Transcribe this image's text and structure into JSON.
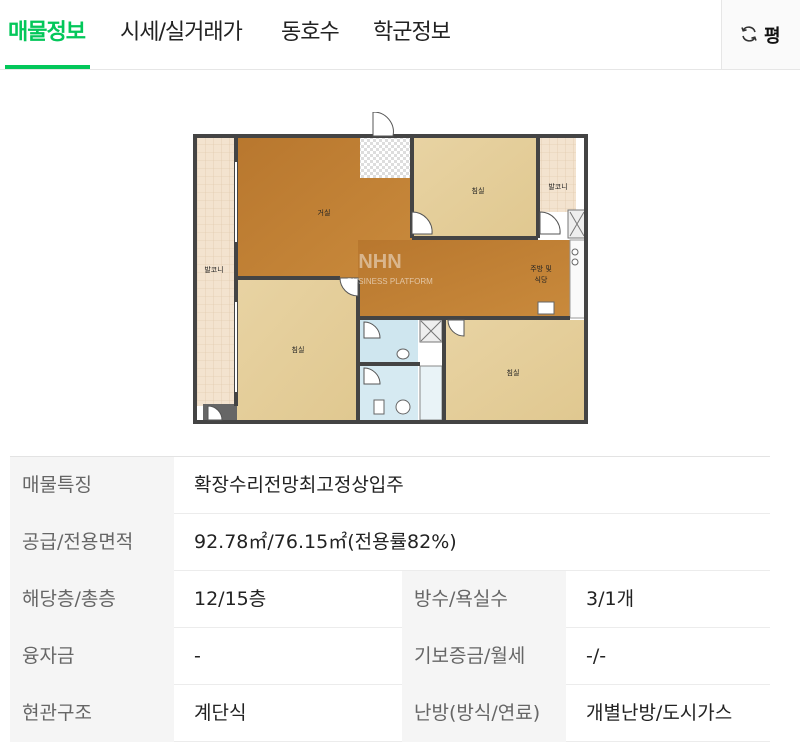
{
  "tabs": [
    {
      "label": "매물정보",
      "active": true
    },
    {
      "label": "시세/실거래가",
      "active": false
    },
    {
      "label": "동호수",
      "active": false
    },
    {
      "label": "학군정보",
      "active": false
    }
  ],
  "unit_toggle": {
    "icon": "refresh-icon",
    "label": "평"
  },
  "accent_color": "#03c75a",
  "floorplan": {
    "watermark": "NHN",
    "watermark_sub": "BUSINESS PLATFORM",
    "rooms": {
      "living": "거실",
      "bedroom_top": "침실",
      "bedroom_left": "침실",
      "bedroom_bottom": "침실",
      "kitchen_line1": "주방 및",
      "kitchen_line2": "식당",
      "balcony_left": "발코니",
      "balcony_right": "발코니"
    }
  },
  "info": {
    "feature": {
      "label": "매물특징",
      "value": "확장수리전망최고정상입주"
    },
    "area": {
      "label": "공급/전용면적",
      "value": "92.78㎡/76.15㎡(전용률82%)"
    },
    "floor": {
      "label": "해당층/총층",
      "value": "12/15층"
    },
    "rooms": {
      "label": "방수/욕실수",
      "value": "3/1개"
    },
    "loan": {
      "label": "융자금",
      "value": "-"
    },
    "deposit": {
      "label": "기보증금/월세",
      "value": "-/-"
    },
    "entrance": {
      "label": "현관구조",
      "value": "계단식"
    },
    "heating": {
      "label": "난방(방식/연료)",
      "value": "개별난방/도시가스"
    }
  }
}
